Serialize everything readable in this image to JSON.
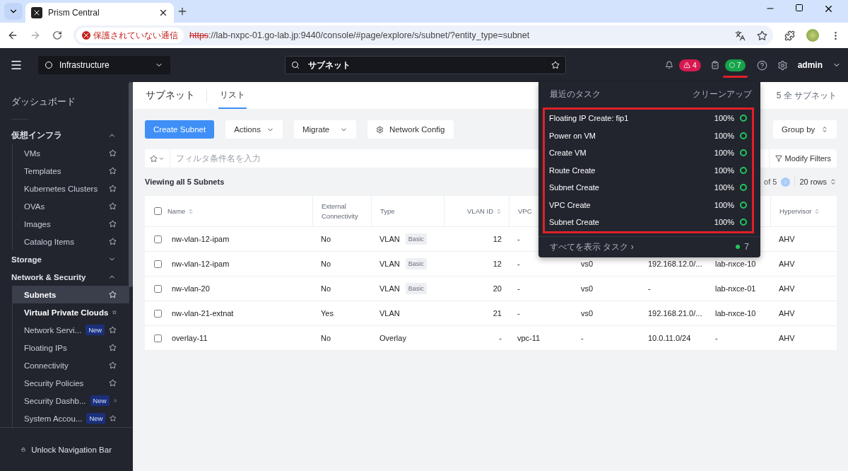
{
  "browser": {
    "tabs": [
      {
        "title": "Prism Central",
        "selected": true
      }
    ],
    "security_label": "保護されていない通信",
    "url_scheme": "https",
    "url_rest": "://lab-nxpc-01.go-lab.jp:9440/console/#page/explore/s/subnet/?entity_type=subnet"
  },
  "header": {
    "app_selector": "Infrastructure",
    "search_value": "サブネット",
    "alerts_count": "4",
    "tasks_count": "7",
    "user": "admin"
  },
  "sidebar": {
    "dashboard": "ダッシュボード",
    "sections": [
      {
        "label": "仮想インフラ",
        "expanded": true,
        "children": [
          {
            "label": "VMs",
            "selected": false,
            "highlighted": false
          },
          {
            "label": "Templates",
            "selected": false,
            "highlighted": false
          },
          {
            "label": "Kubernetes Clusters",
            "selected": false,
            "highlighted": false
          },
          {
            "label": "OVAs",
            "selected": false,
            "highlighted": false
          },
          {
            "label": "Images",
            "selected": false,
            "highlighted": false
          },
          {
            "label": "Catalog Items",
            "selected": false,
            "highlighted": false
          }
        ]
      },
      {
        "label": "Storage",
        "expanded": false
      },
      {
        "label": "Network & Security",
        "expanded": true,
        "children": [
          {
            "label": "Subnets",
            "selected": true,
            "highlighted": false
          },
          {
            "label": "Virtual Private Clouds",
            "selected": false,
            "highlighted": true
          },
          {
            "label": "Network Servi...",
            "badge": "New",
            "selected": false,
            "highlighted": false
          },
          {
            "label": "Floating IPs",
            "selected": false,
            "highlighted": false
          },
          {
            "label": "Connectivity",
            "selected": false,
            "highlighted": false
          },
          {
            "label": "Security Policies",
            "selected": false,
            "highlighted": false
          },
          {
            "label": "Security Dashb...",
            "badge": "New",
            "selected": false,
            "highlighted": false
          },
          {
            "label": "System Accou...",
            "badge": "New",
            "selected": false,
            "highlighted": false
          }
        ]
      }
    ],
    "footer": "Unlock Navigation Bar"
  },
  "page": {
    "title": "サブネット",
    "tabs": [
      {
        "label": "リスト",
        "selected": true
      }
    ],
    "total": "5 全 サブネット"
  },
  "toolbar": {
    "primary": "Create Subnet",
    "actions": "Actions",
    "migrate": "Migrate",
    "network_config": "Network Config",
    "group_by": "Group by"
  },
  "filter": {
    "placeholder": "フィルタ条件名を入力",
    "modify": "Modify Filters"
  },
  "summary": "Viewing all 5 Subnets",
  "pagination": {
    "range": "of 5",
    "rows": "20 rows"
  },
  "table": {
    "select_all_checked": false,
    "columns": [
      "Name",
      "External Connectivity",
      "Type",
      "VLAN ID",
      "VPC",
      null,
      null,
      null,
      "Hypervisor"
    ],
    "rows": [
      {
        "checked": false,
        "cells": [
          "nw-vlan-12-ipam",
          "No",
          "VLAN",
          "12",
          "-",
          null,
          null,
          null,
          "AHV"
        ],
        "type_tag": "Basic"
      },
      {
        "checked": false,
        "cells": [
          "nw-vlan-12-ipam",
          "No",
          "VLAN",
          "12",
          "-",
          "vs0",
          "192.168.12.0/...",
          "lab-nxce-10",
          "AHV"
        ],
        "type_tag": "Basic"
      },
      {
        "checked": false,
        "cells": [
          "nw-vlan-20",
          "No",
          "VLAN",
          "20",
          "-",
          "vs0",
          "-",
          "lab-nxce-01",
          "AHV"
        ],
        "type_tag": "Basic"
      },
      {
        "checked": false,
        "cells": [
          "nw-vlan-21-extnat",
          "Yes",
          "VLAN",
          "21",
          "-",
          "vs0",
          "192.168.21.0/...",
          "lab-nxce-10",
          "AHV"
        ]
      },
      {
        "checked": false,
        "cells": [
          "overlay-11",
          "No",
          "Overlay",
          "-",
          "vpc-11",
          "-",
          "10.0.11.0/24",
          "-",
          "AHV"
        ]
      }
    ]
  },
  "tasks_popup": {
    "title": "最近のタスク",
    "cleanup": "クリーンアップ",
    "highlighted": true,
    "tasks": [
      {
        "name": "Floating IP Create: fip1",
        "progress": "100%"
      },
      {
        "name": "Power on VM",
        "progress": "100%"
      },
      {
        "name": "Create VM",
        "progress": "100%"
      },
      {
        "name": "Route Create",
        "progress": "100%"
      },
      {
        "name": "Subnet Create",
        "progress": "100%"
      },
      {
        "name": "VPC Create",
        "progress": "100%"
      },
      {
        "name": "Subnet Create",
        "progress": "100%"
      }
    ],
    "view_all": "すべてを表示 タスク ›",
    "count": "7"
  }
}
